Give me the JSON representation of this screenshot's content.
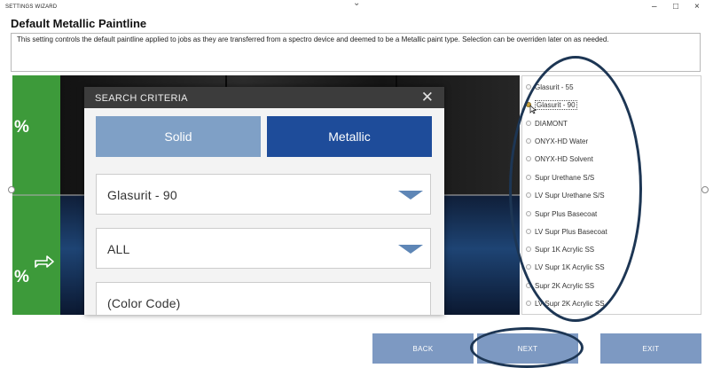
{
  "window": {
    "app_name": "SETTINGS WIZARD",
    "chevron": "⌄",
    "minimize": "–",
    "maximize": "□",
    "close": "×"
  },
  "header": {
    "title": "Default Metallic Paintline",
    "description": "This setting controls the default paintline applied to jobs as they are transferred from a spectro device and deemed to be a Metallic paint type.  Selection can be overriden later on as needed."
  },
  "background": {
    "percent_top": "%",
    "percent_bottom": "%"
  },
  "dialog": {
    "title": "SEARCH CRITERIA",
    "close": "✕",
    "tabs": [
      "Solid",
      "Metallic"
    ],
    "active_tab": "Metallic",
    "paintline_value": "Glasurit - 90",
    "filter_value": "ALL",
    "color_code_placeholder": "(Color Code)"
  },
  "paintline_list": {
    "selected": "Glasurit - 90",
    "items": [
      "Glasurit - 55",
      "Glasurit - 90",
      "DIAMONT",
      "ONYX-HD Water",
      "ONYX-HD Solvent",
      "Supr Urethane S/S",
      "LV Supr Urethane S/S",
      "Supr Plus Basecoat",
      "LV Supr Plus Basecoat",
      "Supr 1K Acrylic SS",
      "LV Supr 1K Acrylic SS",
      "Supr 2K Acrylic SS",
      "LV Supr 2K Acrylic SS"
    ]
  },
  "footer": {
    "back": "BACK",
    "next": "NEXT",
    "exit": "EXIT"
  },
  "colors": {
    "accent": "#1e4c9a",
    "inactive_tab": "#7fa0c6",
    "footer_button": "#7d99c2",
    "annotation": "#1d3654",
    "dialog_header": "#3c3c3c"
  }
}
